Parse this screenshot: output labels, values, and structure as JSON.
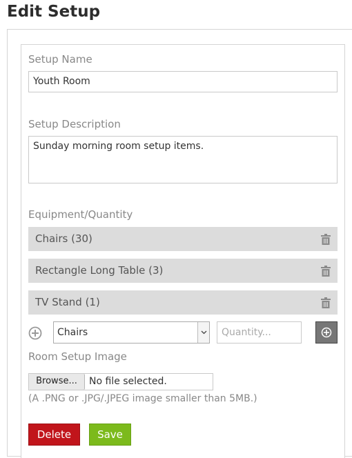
{
  "page": {
    "title": "Edit Setup"
  },
  "form": {
    "setup_name_label": "Setup Name",
    "setup_name_value": "Youth Room",
    "setup_description_label": "Setup Description",
    "setup_description_value": "Sunday morning room setup items.",
    "equipment_label": "Equipment/Quantity",
    "equipment": [
      {
        "label": "Chairs (30)",
        "icon": "trash-icon"
      },
      {
        "label": "Rectangle Long Table (3)",
        "icon": "trash-icon"
      },
      {
        "label": "TV Stand (1)",
        "icon": "trash-icon"
      }
    ],
    "equipment_select_value": "Chairs",
    "quantity_placeholder": "Quantity...",
    "image_label": "Room Setup Image",
    "browse_label": "Browse...",
    "file_status": "No file selected.",
    "image_hint": "(A .PNG or .JPG/.JPEG image smaller than 5MB.)"
  },
  "actions": {
    "delete_label": "Delete",
    "save_label": "Save"
  },
  "colors": {
    "delete": "#c1151b",
    "save": "#7cba1c",
    "row_bg": "#dcdcdc"
  }
}
